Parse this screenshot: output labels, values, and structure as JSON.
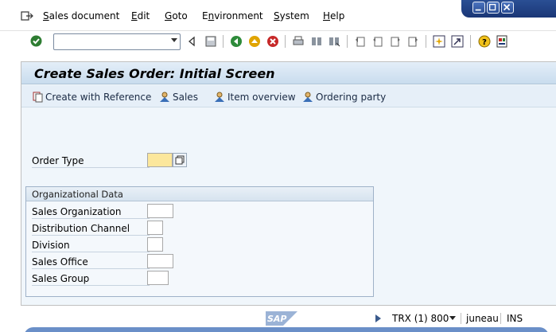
{
  "menubar": {
    "items": [
      {
        "label": "Sales document",
        "u": "S",
        "rest": "ales document"
      },
      {
        "label": "Edit",
        "u": "E",
        "rest": "dit"
      },
      {
        "label": "Goto",
        "u": "G",
        "rest": "oto"
      },
      {
        "label": "Environment",
        "u": "n",
        "pre": "E",
        "rest": "vironment"
      },
      {
        "label": "System",
        "u": "S",
        "rest": "ystem"
      },
      {
        "label": "Help",
        "u": "H",
        "rest": "elp"
      }
    ]
  },
  "toolbar": {
    "command_field_value": "",
    "icons": [
      "ok-icon",
      "back-arrow-icon",
      "save-icon",
      "back-icon",
      "exit-icon",
      "cancel-icon",
      "print-icon",
      "find-icon",
      "find-next-icon",
      "first-page-icon",
      "previous-page-icon",
      "next-page-icon",
      "last-page-icon",
      "create-session-icon",
      "shortcut-icon",
      "help-icon",
      "layout-icon"
    ]
  },
  "main": {
    "title": "Create Sales Order: Initial Screen",
    "app_buttons": [
      {
        "label": "Create with Reference",
        "icon": "copy-reference-icon"
      },
      {
        "label": "Sales",
        "icon": "person-icon"
      },
      {
        "label": "Item overview",
        "icon": "person-icon"
      },
      {
        "label": "Ordering party",
        "icon": "person-icon"
      }
    ],
    "order_type": {
      "label": "Order Type",
      "value": ""
    },
    "org_data": {
      "title": "Organizational Data",
      "fields": [
        {
          "label": "Sales Organization",
          "value": ""
        },
        {
          "label": "Distribution Channel",
          "value": ""
        },
        {
          "label": "Division",
          "value": ""
        },
        {
          "label": "Sales Office",
          "value": ""
        },
        {
          "label": "Sales Group",
          "value": ""
        }
      ]
    }
  },
  "status": {
    "logo": "SAP",
    "system": "TRX (1) 800",
    "server": "juneau",
    "mode": "INS"
  },
  "colors": {
    "required_field": "#fce79c",
    "title_bar": "#c9dcee",
    "window_control": "#1a3676"
  }
}
